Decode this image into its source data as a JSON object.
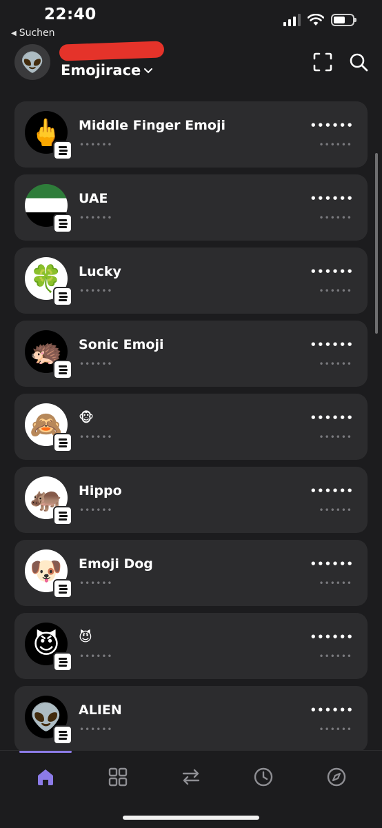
{
  "status_bar": {
    "time": "22:40",
    "back_label": "Suchen",
    "back_arrow": "◀"
  },
  "header": {
    "avatar_icon": "👽",
    "wallet_name": "Emojirace",
    "chevron": "⌄",
    "scan_icon": "scan-icon",
    "search_icon": "search-icon"
  },
  "tokens": [
    {
      "icon": "🖕",
      "icon_bg": "#000000",
      "name": "Middle Finger Emoji",
      "value": "••••••",
      "sub": "••••••",
      "change": "••••••"
    },
    {
      "icon": "",
      "icon_bg": "flag-uae",
      "name": "UAE",
      "value": "••••••",
      "sub": "••••••",
      "change": "••••••"
    },
    {
      "icon": "🍀",
      "icon_bg": "#ffffff",
      "name": "Lucky",
      "value": "••••••",
      "sub": "••••••",
      "change": "••••••"
    },
    {
      "icon": "🦔",
      "icon_bg": "#000000",
      "name": "Sonic Emoji",
      "value": "••••••",
      "sub": "••••••",
      "change": "••••••"
    },
    {
      "icon": "🙈",
      "icon_bg": "#ffffff",
      "name": "🐵",
      "value": "••••••",
      "sub": "••••••",
      "change": "••••••"
    },
    {
      "icon": "🦛",
      "icon_bg": "#ffffff",
      "name": "Hippo",
      "value": "••••••",
      "sub": "••••••",
      "change": "••••••"
    },
    {
      "icon": "🐶",
      "icon_bg": "#ffffff",
      "name": "Emoji Dog",
      "value": "••••••",
      "sub": "••••••",
      "change": "••••••"
    },
    {
      "icon": "😈",
      "icon_bg": "#000000",
      "name": "😈",
      "value": "••••••",
      "sub": "••••••",
      "change": "••••••"
    },
    {
      "icon": "👽",
      "icon_bg": "#000000",
      "name": "ALIEN",
      "value": "••••••",
      "sub": "••••••",
      "change": "••••••"
    }
  ],
  "tab_bar": {
    "tabs": [
      {
        "name": "home-icon",
        "active": true
      },
      {
        "name": "grid-icon",
        "active": false
      },
      {
        "name": "swap-icon",
        "active": false
      },
      {
        "name": "history-clock-icon",
        "active": false
      },
      {
        "name": "explore-compass-icon",
        "active": false
      }
    ],
    "accent_color": "#8c7be8",
    "inactive_color": "#8e8e93"
  }
}
